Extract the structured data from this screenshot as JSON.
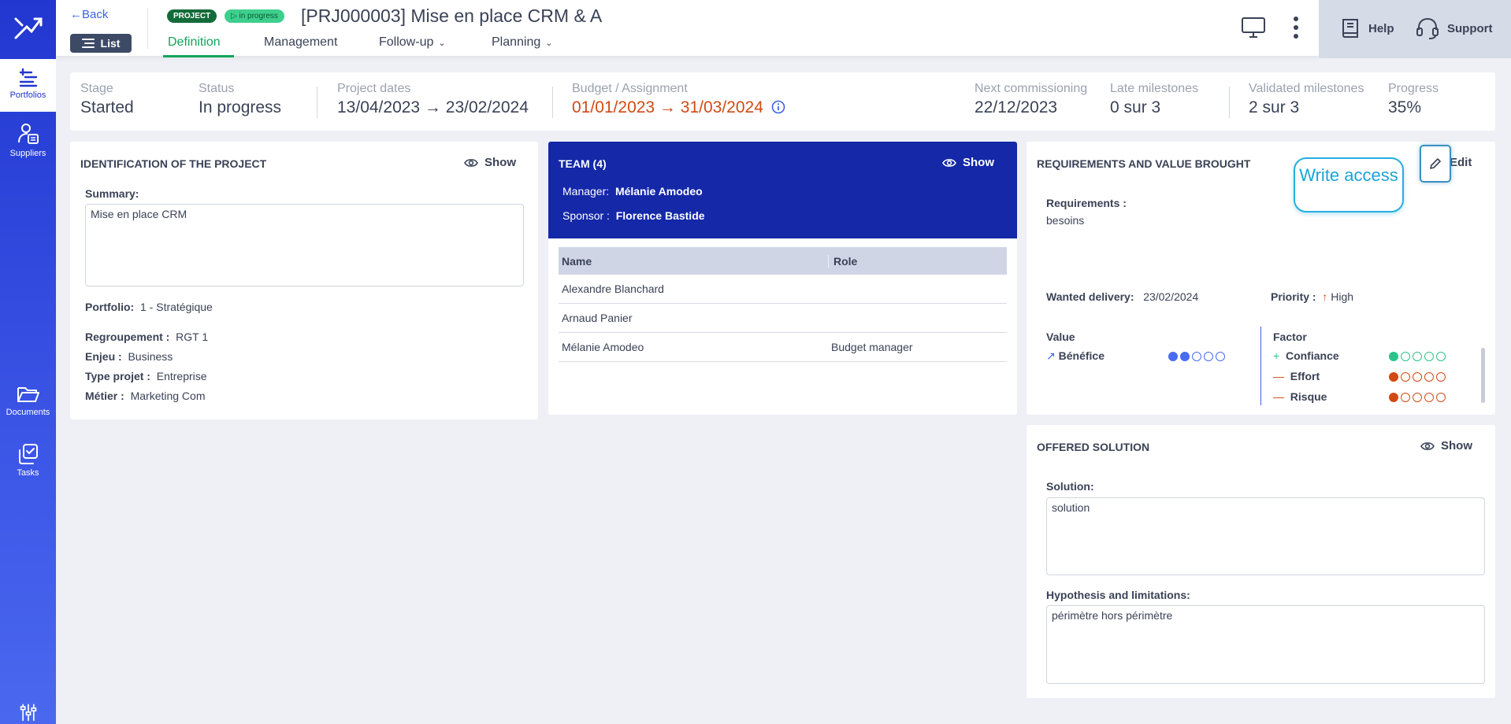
{
  "sidebar": {
    "items": [
      {
        "label": "Portfolios"
      },
      {
        "label": "Suppliers"
      },
      {
        "label": "Documents"
      },
      {
        "label": "Tasks"
      }
    ]
  },
  "header": {
    "back_label": "Back",
    "list_label": "List",
    "badge_project": "PROJECT",
    "badge_status": "in progress",
    "title": "[PRJ000003] Mise en place CRM & A",
    "tabs": [
      {
        "label": "Definition"
      },
      {
        "label": "Management"
      },
      {
        "label": "Follow-up"
      },
      {
        "label": "Planning"
      }
    ],
    "help_label": "Help",
    "support_label": "Support"
  },
  "summary": {
    "stage": {
      "label": "Stage",
      "value": "Started"
    },
    "status": {
      "label": "Status",
      "value": "In progress"
    },
    "dates": {
      "label": "Project dates",
      "value": "13/04/2023 → 23/02/2024"
    },
    "budget": {
      "label": "Budget / Assignment",
      "value": "01/01/2023 → 31/03/2024"
    },
    "next": {
      "label": "Next commissioning",
      "value": "22/12/2023"
    },
    "late": {
      "label": "Late milestones",
      "value": "0 sur 3"
    },
    "validated": {
      "label": "Validated milestones",
      "value": "2 sur 3"
    },
    "progress": {
      "label": "Progress",
      "value": "35%"
    }
  },
  "identification": {
    "title": "IDENTIFICATION OF THE PROJECT",
    "show_label": "Show",
    "summary_label": "Summary:",
    "summary_value": "Mise en place CRM",
    "portfolio_label": "Portfolio:",
    "portfolio_value": "1 - Stratégique",
    "regroupement_label": "Regroupement :",
    "regroupement_value": "RGT 1",
    "enjeu_label": "Enjeu :",
    "enjeu_value": "Business",
    "type_label": "Type projet :",
    "type_value": "Entreprise",
    "metier_label": "Métier :",
    "metier_value": "Marketing Com"
  },
  "team": {
    "title": "TEAM (4)",
    "show_label": "Show",
    "manager_label": "Manager:",
    "manager_value": "Mélanie Amodeo",
    "sponsor_label": "Sponsor :",
    "sponsor_value": "Florence Bastide",
    "columns": [
      "Name",
      "Role"
    ],
    "rows": [
      {
        "name": "Alexandre Blanchard",
        "role": ""
      },
      {
        "name": "Arnaud Panier",
        "role": ""
      },
      {
        "name": "Mélanie Amodeo",
        "role": "Budget manager"
      }
    ]
  },
  "requirements": {
    "title": "REQUIREMENTS AND VALUE BROUGHT",
    "edit_label": "Edit",
    "req_label": "Requirements :",
    "req_value": "besoins",
    "wanted_label": "Wanted delivery:",
    "wanted_value": "23/02/2024",
    "priority_label": "Priority :",
    "priority_value": "High",
    "value_head": "Value",
    "factor_head": "Factor",
    "value_items": [
      {
        "label": "Bénéfice",
        "level": 2,
        "max": 5,
        "color": "#4a6cf0"
      }
    ],
    "factors": [
      {
        "sign": "+",
        "label": "Confiance",
        "level": 1,
        "max": 5,
        "color": "#2bc48a"
      },
      {
        "sign": "—",
        "label": "Effort",
        "level": 1,
        "max": 5,
        "color": "#d14a14"
      },
      {
        "sign": "—",
        "label": "Risque",
        "level": 1,
        "max": 5,
        "color": "#d14a14"
      }
    ],
    "callout": "Write access"
  },
  "solution": {
    "title": "OFFERED SOLUTION",
    "show_label": "Show",
    "solution_label": "Solution:",
    "solution_value": "solution",
    "hypo_label": "Hypothesis and limitations:",
    "hypo_value": "périmètre hors périmètre"
  },
  "colors": {
    "accent": "#2237d0",
    "team_header": "#1428a8",
    "active_tab": "#14a35a",
    "date_alert": "#d14a14"
  }
}
